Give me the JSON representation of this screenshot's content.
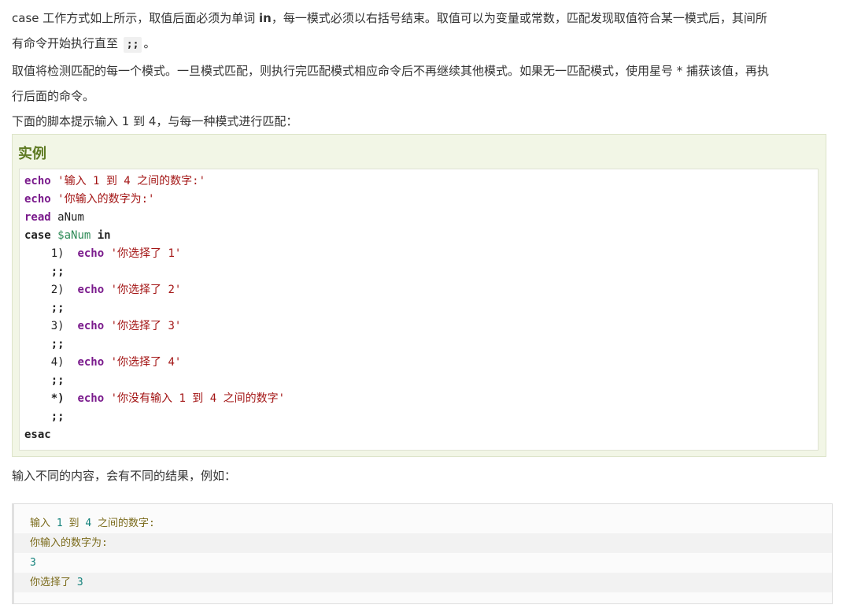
{
  "intro": {
    "line1_a": "case 工作方式如上所示，取值后面必须为单词 ",
    "line1_kw": "in",
    "line1_b": "，每一模式必须以右括号结束。取值可以为变量或常数，匹配发现取值符合某一模式后，其间所",
    "line2_a": "有命令开始执行直至 ",
    "line2_code": ";;",
    "line2_b": "。"
  },
  "para2": {
    "line1": "取值将检测匹配的每一个模式。一旦模式匹配，则执行完匹配模式相应命令后不再继续其他模式。如果无一匹配模式，使用星号 * 捕获该值，再执",
    "line2": "行后面的命令。"
  },
  "para3": "下面的脚本提示输入 1 到 4，与每一种模式进行匹配：",
  "example": {
    "title": "实例",
    "code": {
      "echo": "echo",
      "read": "read",
      "case": "case",
      "in": "in",
      "esac": "esac",
      "l1_str": "'输入 1 到 4 之间的数字:'",
      "l2_str": "'你输入的数字为:'",
      "l3_var": "aNum",
      "l4_var": "$aNum",
      "l5_pat": "1)",
      "l5_str": "'你选择了 1'",
      "l7_pat": "2)",
      "l7_str": "'你选择了 2'",
      "l9_pat": "3)",
      "l9_str": "'你选择了 3'",
      "l11_pat": "4)",
      "l11_str": "'你选择了 4'",
      "l13_pat": "*)",
      "l13_str": "'你没有输入 1 到 4 之间的数字'",
      "terminator": ";;"
    }
  },
  "para4": "输入不同的内容，会有不同的结果，例如：",
  "output": {
    "l1_a": "输入 ",
    "l1_n1": "1",
    "l1_b": " 到 ",
    "l1_n2": "4",
    "l1_c": " 之间的数字:",
    "l2": "你输入的数字为:",
    "l3": "3",
    "l4_a": "你选择了 ",
    "l4_n": "3"
  }
}
